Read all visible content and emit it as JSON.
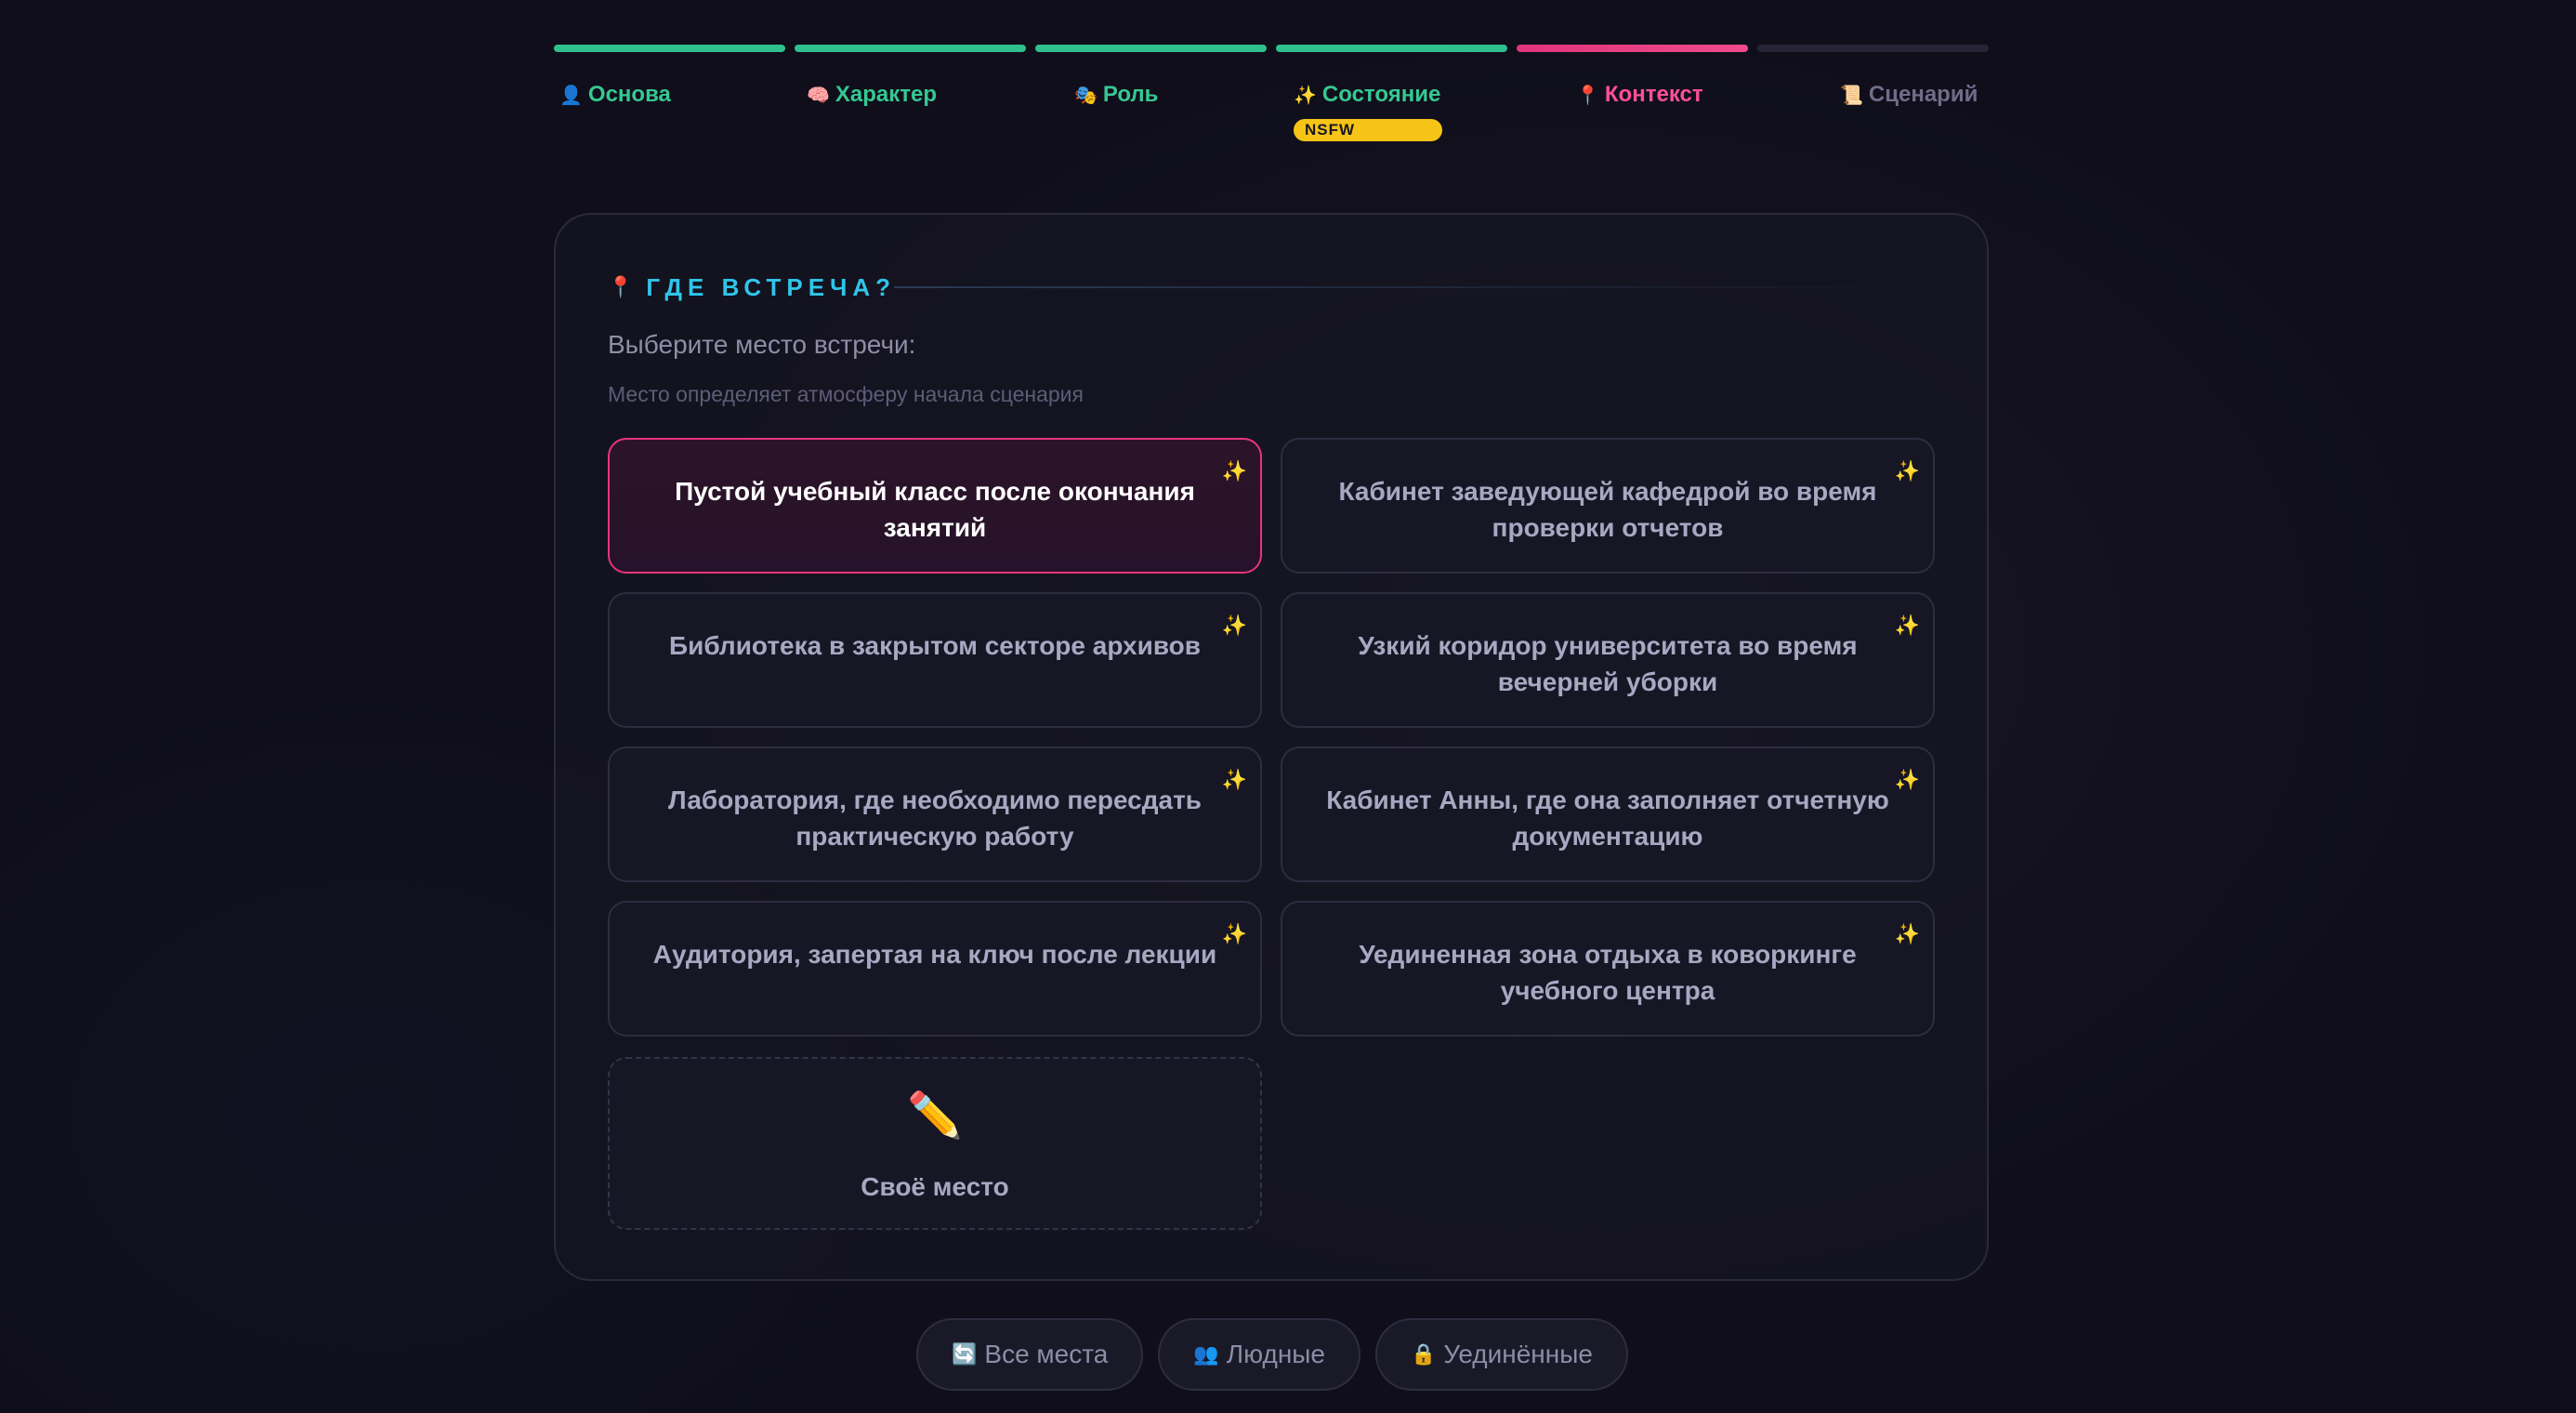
{
  "steps": [
    {
      "icon": "👤",
      "icon_name": "person-icon",
      "label": "Основа",
      "state": "done"
    },
    {
      "icon": "🧠",
      "icon_name": "brain-icon",
      "label": "Характер",
      "state": "done"
    },
    {
      "icon": "🎭",
      "icon_name": "theater-masks-icon",
      "label": "Роль",
      "state": "done"
    },
    {
      "icon": "✨",
      "icon_name": "sparkles-icon",
      "label": "Состояние",
      "state": "done"
    },
    {
      "icon": "📍",
      "icon_name": "pin-icon",
      "label": "Контекст",
      "state": "active"
    },
    {
      "icon": "📜",
      "icon_name": "scroll-icon",
      "label": "Сценарий",
      "state": "todo"
    }
  ],
  "badge": "NSFW",
  "section": {
    "icon": "📍",
    "title": "ГДЕ ВСТРЕЧА?",
    "prompt": "Выберите место встречи:",
    "hint": "Место определяет атмосферу начала сценария"
  },
  "options": [
    {
      "label": "Пустой учебный класс после окончания занятий",
      "selected": true
    },
    {
      "label": "Кабинет заведующей кафедрой во время проверки отчетов",
      "selected": false
    },
    {
      "label": "Библиотека в закрытом секторе архивов",
      "selected": false
    },
    {
      "label": "Узкий коридор университета во время вечерней уборки",
      "selected": false
    },
    {
      "label": "Лаборатория, где необходимо пересдать практическую работу",
      "selected": false
    },
    {
      "label": "Кабинет Анны, где она заполняет отчетную документацию",
      "selected": false
    },
    {
      "label": "Аудитория, запертая на ключ после лекции",
      "selected": false
    },
    {
      "label": "Уединенная зона отдыха в коворкинге учебного центра",
      "selected": false
    }
  ],
  "spark_icon": "✨",
  "custom": {
    "icon": "✏️",
    "label": "Своё место"
  },
  "filters": [
    {
      "icon": "🔄",
      "icon_name": "refresh-icon",
      "label": "Все места"
    },
    {
      "icon": "👥",
      "icon_name": "people-icon",
      "label": "Людные"
    },
    {
      "icon": "🔒",
      "icon_name": "lock-icon",
      "label": "Уединённые"
    }
  ],
  "colors": {
    "done": "#2fc08e",
    "active": "#e6357c",
    "heading": "#2fc5ea",
    "badge": "#f5c417"
  }
}
